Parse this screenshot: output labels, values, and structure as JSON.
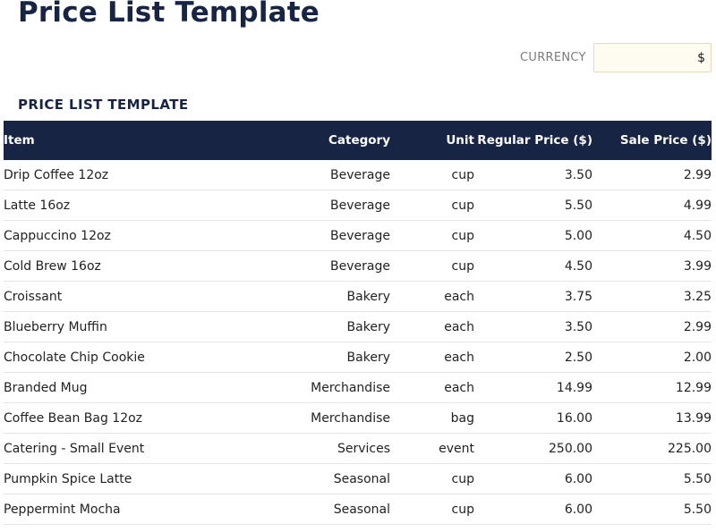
{
  "page_title": "Price List Template",
  "currency": {
    "label": "CURRENCY",
    "value": "$"
  },
  "section_title": "PRICE LIST TEMPLATE",
  "table": {
    "headers": [
      "Item",
      "Category",
      "Unit",
      "Regular Price ($)",
      "Sale Price ($)"
    ],
    "rows": [
      [
        "Drip Coffee 12oz",
        "Beverage",
        "cup",
        "3.50",
        "2.99"
      ],
      [
        "Latte 16oz",
        "Beverage",
        "cup",
        "5.50",
        "4.99"
      ],
      [
        "Cappuccino 12oz",
        "Beverage",
        "cup",
        "5.00",
        "4.50"
      ],
      [
        "Cold Brew 16oz",
        "Beverage",
        "cup",
        "4.50",
        "3.99"
      ],
      [
        "Croissant",
        "Bakery",
        "each",
        "3.75",
        "3.25"
      ],
      [
        "Blueberry Muffin",
        "Bakery",
        "each",
        "3.50",
        "2.99"
      ],
      [
        "Chocolate Chip Cookie",
        "Bakery",
        "each",
        "2.50",
        "2.00"
      ],
      [
        "Branded Mug",
        "Merchandise",
        "each",
        "14.99",
        "12.99"
      ],
      [
        "Coffee Bean Bag 12oz",
        "Merchandise",
        "bag",
        "16.00",
        "13.99"
      ],
      [
        "Catering - Small Event",
        "Services",
        "event",
        "250.00",
        "225.00"
      ],
      [
        "Pumpkin Spice Latte",
        "Seasonal",
        "cup",
        "6.00",
        "5.50"
      ],
      [
        "Peppermint Mocha",
        "Seasonal",
        "cup",
        "6.00",
        "5.50"
      ]
    ]
  },
  "colors": {
    "header_bg": "#172443",
    "title_color": "#172443",
    "input_bg": "#fefbf1"
  }
}
